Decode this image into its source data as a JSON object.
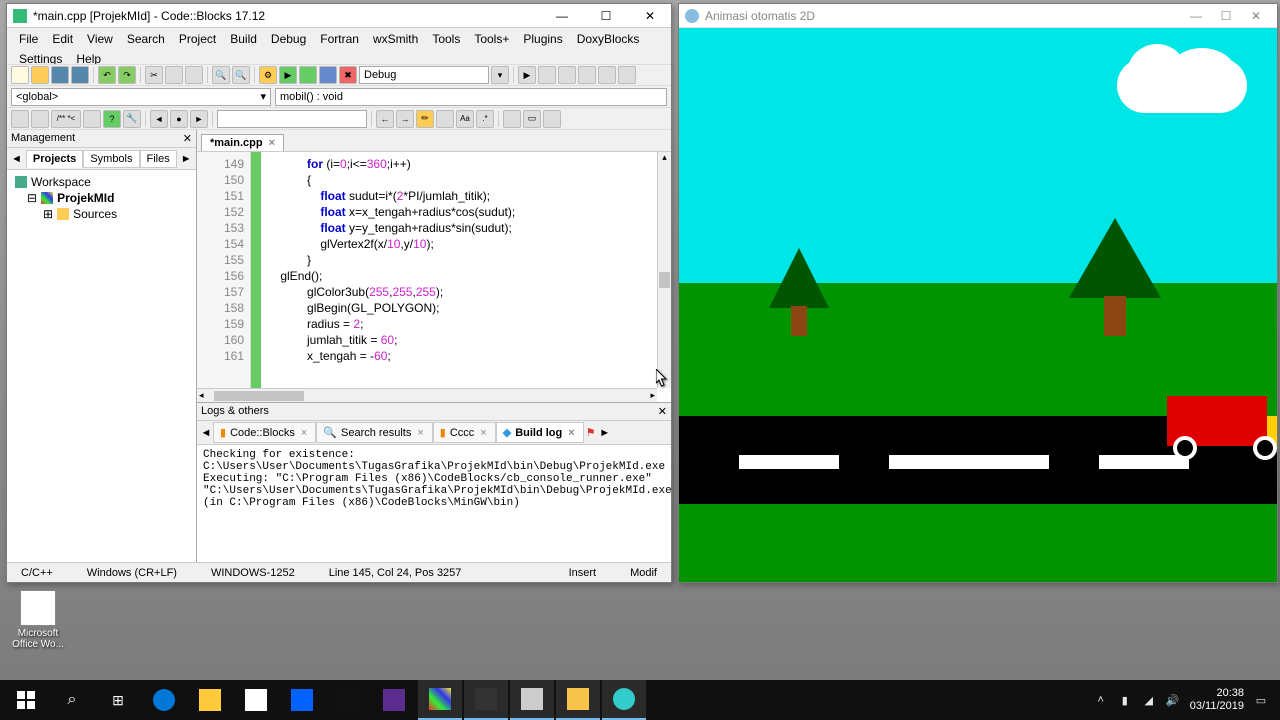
{
  "codeblocks": {
    "title": "*main.cpp [ProjekMId] - Code::Blocks 17.12",
    "menu": [
      "File",
      "Edit",
      "View",
      "Search",
      "Project",
      "Build",
      "Debug",
      "Fortran",
      "wxSmith",
      "Tools",
      "Tools+",
      "Plugins",
      "DoxyBlocks",
      "Settings",
      "Help"
    ],
    "debug_combo": "Debug",
    "scope_global": "<global>",
    "scope_func": "mobil() : void",
    "management": {
      "title": "Management",
      "tabs": [
        "Projects",
        "Symbols",
        "Files"
      ],
      "tree": {
        "workspace": "Workspace",
        "project": "ProjekMId",
        "sources": "Sources"
      }
    },
    "editor": {
      "tab": "*main.cpp",
      "lines_start": 149,
      "lines": [
        "            for (i=0;i<=360;i++)",
        "            {",
        "                float sudut=i*(2*PI/jumlah_titik);",
        "                float x=x_tengah+radius*cos(sudut);",
        "                float y=y_tengah+radius*sin(sudut);",
        "                glVertex2f(x/10,y/10);",
        "            }",
        "    glEnd();",
        "            glColor3ub(255,255,255);",
        "            glBegin(GL_POLYGON);",
        "            radius = 2;",
        "            jumlah_titik = 60;",
        "            x_tengah = -60;"
      ]
    },
    "logs": {
      "title": "Logs & others",
      "tabs": [
        "Code::Blocks",
        "Search results",
        "Cccc",
        "Build log"
      ],
      "active_tab": "Build log",
      "body": "Checking for existence: C:\\Users\\User\\Documents\\TugasGrafika\\ProjekMId\\bin\\Debug\\ProjekMId.exe\nExecuting: \"C:\\Program Files (x86)\\CodeBlocks/cb_console_runner.exe\" \"C:\\Users\\User\\Documents\\TugasGrafika\\ProjekMId\\bin\\Debug\\ProjekMId.exe\"  (in C:\\Program Files (x86)\\CodeBlocks\\MinGW\\bin)"
    },
    "status": {
      "lang": "C/C++",
      "eol": "Windows (CR+LF)",
      "enc": "WINDOWS-1252",
      "pos": "Line 145, Col 24, Pos 3257",
      "ins": "Insert",
      "mod": "Modif"
    }
  },
  "glwin": {
    "title": "Animasi otomatis 2D"
  },
  "desktop": {
    "icon1": "Microsoft Office Wo..."
  },
  "tray": {
    "time": "20:38",
    "date": "03/11/2019"
  }
}
